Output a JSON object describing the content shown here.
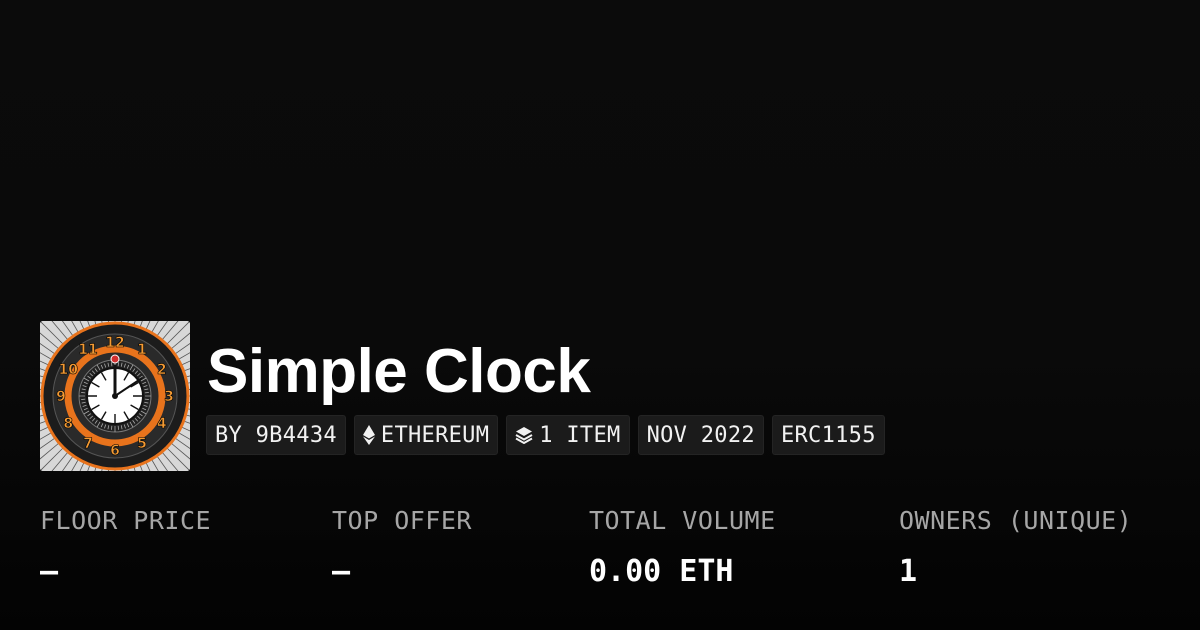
{
  "collection": {
    "name": "Simple Clock",
    "thumbnail_icon": "clock-artwork"
  },
  "tags": {
    "creator": "BY 9B4434",
    "chain": "ETHEREUM",
    "chain_icon": "ethereum-icon",
    "items": "1 ITEM",
    "items_icon": "layers-icon",
    "date": "NOV 2022",
    "standard": "ERC1155"
  },
  "stats": {
    "floor_price": {
      "label": "FLOOR PRICE",
      "value": "—"
    },
    "top_offer": {
      "label": "TOP OFFER",
      "value": "—"
    },
    "total_volume": {
      "label": "TOTAL VOLUME",
      "value": "0.00 ETH"
    },
    "owners": {
      "label": "OWNERS (UNIQUE)",
      "value": "1"
    }
  },
  "colors": {
    "background": "#0a0a0a",
    "tag_background": "#1b1b1b",
    "label_gray": "#a6a6a6",
    "clock_orange": "#e8731c"
  },
  "artwork": {
    "numerals": [
      "12",
      "1",
      "2",
      "3",
      "4",
      "5",
      "6",
      "7",
      "8",
      "9",
      "10",
      "11"
    ]
  }
}
